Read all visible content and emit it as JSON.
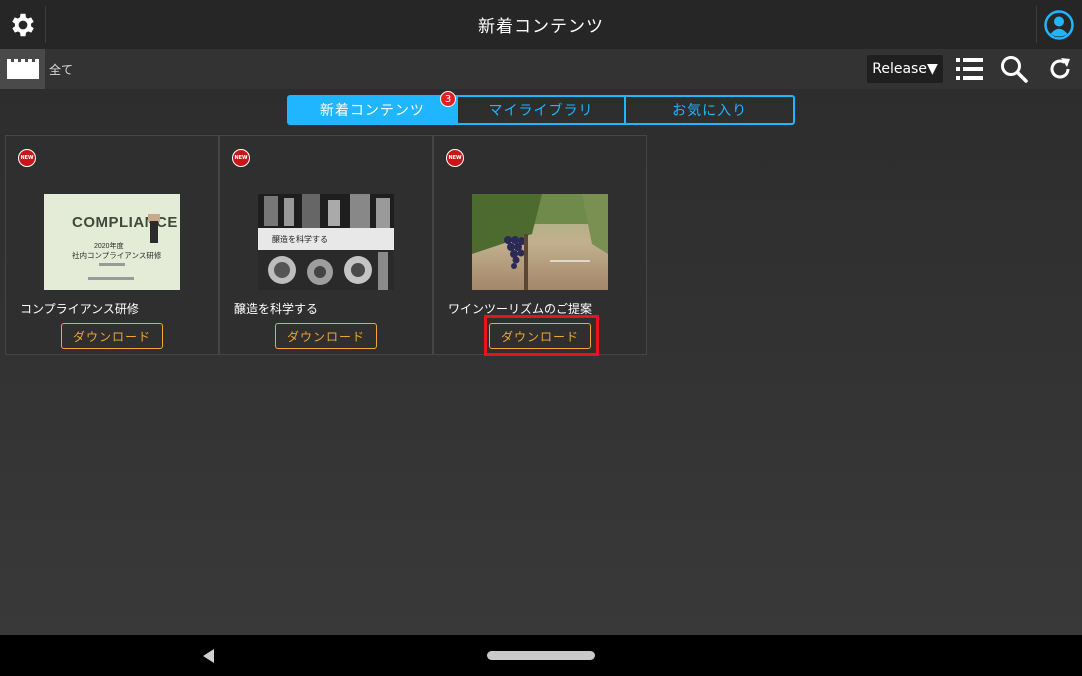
{
  "header": {
    "title": "新着コンテンツ",
    "settings_icon": "gear-icon",
    "account_icon": "user-avatar-icon"
  },
  "toolbar": {
    "folder_icon": "folder-icon",
    "folder_label": "全て",
    "release_label": "Release▼",
    "list_icon": "list-icon",
    "search_icon": "search-icon",
    "refresh_icon": "refresh-icon"
  },
  "tabs": [
    {
      "label": "新着コンテンツ",
      "active": true
    },
    {
      "label": "マイライブラリ",
      "active": false
    },
    {
      "label": "お気に入り",
      "active": false
    }
  ],
  "new_badge_count": "3",
  "cards": [
    {
      "title": "コンプライアンス研修",
      "badge": "NEW",
      "button": "ダウンロード",
      "thumb_heading": "COMPLIANCE",
      "thumb_line1": "2020年度",
      "thumb_line2": "社内コンプライアンス研修"
    },
    {
      "title": "醸造を科学する",
      "badge": "NEW",
      "button": "ダウンロード",
      "thumb_heading": "醸造を科学する"
    },
    {
      "title": "ワインツーリズムのご提案",
      "badge": "NEW",
      "button": "ダウンロード"
    }
  ],
  "colors": {
    "accent": "#1fb6ff",
    "download": "#f0a830",
    "highlight": "#e8141a",
    "badge": "#e32020"
  }
}
